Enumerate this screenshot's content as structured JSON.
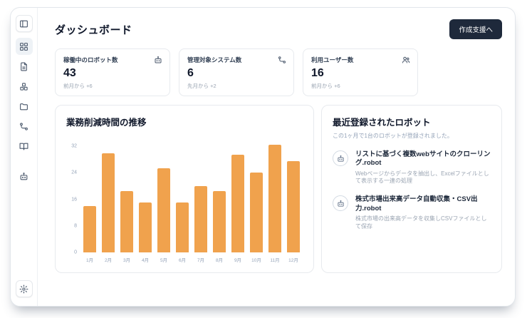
{
  "header": {
    "title": "ダッシュボード",
    "action_button": "作成支援へ"
  },
  "sidebar": {
    "toggle_icon": "panel-left-icon",
    "items": [
      {
        "id": "dashboard",
        "icon": "grid-icon",
        "active": true
      },
      {
        "id": "documents",
        "icon": "file-icon",
        "active": false
      },
      {
        "id": "blocks",
        "icon": "blocks-icon",
        "active": false
      },
      {
        "id": "folders",
        "icon": "folder-icon",
        "active": false
      },
      {
        "id": "workflows",
        "icon": "workflow-icon",
        "active": false
      },
      {
        "id": "library",
        "icon": "book-icon",
        "active": false
      },
      {
        "id": "assistant",
        "icon": "bot-icon",
        "active": false,
        "separated": true
      }
    ],
    "bottom_icon": "gear-icon"
  },
  "stats": [
    {
      "label": "稼働中のロボット数",
      "value": "43",
      "delta": "前月から +6",
      "icon": "robot-icon"
    },
    {
      "label": "管理対象システム数",
      "value": "6",
      "delta": "先月から +2",
      "icon": "workflow-icon"
    },
    {
      "label": "利用ユーザー数",
      "value": "16",
      "delta": "前月から +6",
      "icon": "users-icon"
    }
  ],
  "chart_data": {
    "type": "bar",
    "title": "業務削減時間の推移",
    "categories": [
      "1月",
      "2月",
      "3月",
      "4月",
      "5月",
      "6月",
      "7月",
      "8月",
      "9月",
      "10月",
      "11月",
      "12月"
    ],
    "values": [
      14,
      30,
      18.5,
      15,
      25.5,
      15,
      20,
      18.5,
      29.5,
      24,
      32.5,
      27.5
    ],
    "xlabel": "",
    "ylabel": "",
    "ylim": [
      0,
      34
    ],
    "yticks": [
      0,
      8,
      16,
      24,
      32
    ],
    "bar_color": "#F0A24D",
    "grid": false,
    "legend": false
  },
  "recent_robots": {
    "title": "最近登録されたロボット",
    "subtitle": "この1ヶ月で1台のロボットが登録されました。",
    "item_icon": "bot-icon",
    "items": [
      {
        "name": "リストに基づく複数webサイトのクローリング.robot",
        "description": "Webページからデータを抽出し、Excelファイルとして表示する一連の処理"
      },
      {
        "name": "株式市場出来高データ自動収集・CSV出力.robot",
        "description": "株式市場の出来高データを収集しCSVファイルとして保存"
      }
    ]
  },
  "colors": {
    "accent_orange": "#F0A24D",
    "button_dark": "#1E293B",
    "text_dark": "#0F172A",
    "text_muted": "#94A3B8",
    "card_border": "#E7EAEE"
  }
}
